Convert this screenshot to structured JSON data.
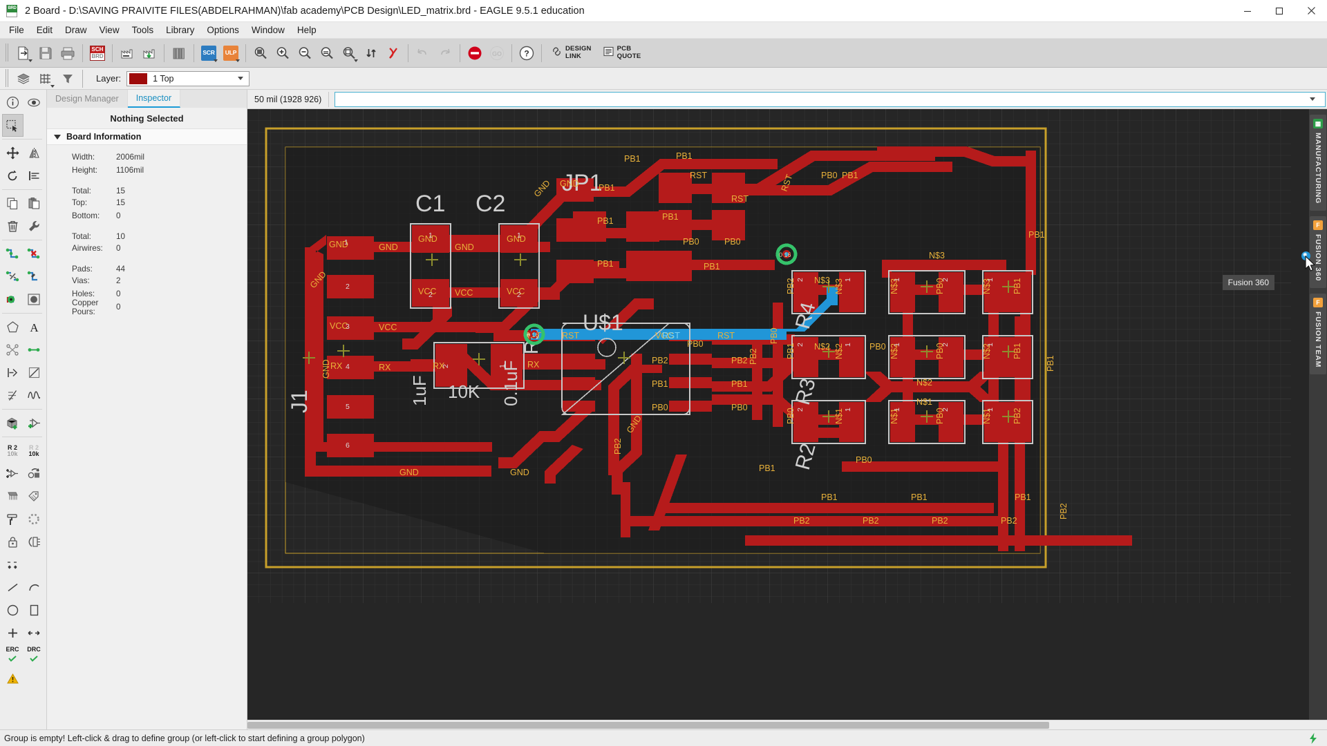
{
  "window": {
    "title": "2 Board - D:\\SAVING PRAIVITE FILES(ABDELRAHMAN)\\fab academy\\PCB Design\\LED_matrix.brd - EAGLE 9.5.1 education",
    "app_icon": "brd-file-icon",
    "minimize": "minimize-icon",
    "maximize": "maximize-icon",
    "close": "close-icon"
  },
  "menubar": {
    "items": [
      {
        "label": "File"
      },
      {
        "label": "Edit"
      },
      {
        "label": "Draw"
      },
      {
        "label": "View"
      },
      {
        "label": "Tools"
      },
      {
        "label": "Library"
      },
      {
        "label": "Options"
      },
      {
        "label": "Window"
      },
      {
        "label": "Help"
      }
    ]
  },
  "toolbar": {
    "buttons": [
      {
        "name": "open-file-button",
        "icon": "open-document-icon",
        "dropdown": true,
        "disabled": false
      },
      {
        "name": "save-button",
        "icon": "floppy-save-icon",
        "dropdown": false,
        "disabled": false
      },
      {
        "name": "print-button",
        "icon": "printer-icon",
        "dropdown": false,
        "disabled": false
      },
      {
        "name": "switch-to-schematic-button",
        "icon": "sch-brd-icon",
        "label_top": "SCH",
        "label_bottom": "BRD",
        "disabled": false
      },
      {
        "name": "cam-processor-button",
        "icon": "cam-factory-icon",
        "disabled": false
      },
      {
        "name": "generate-manufacturing-button",
        "icon": "cam-factory-download-icon",
        "disabled": false
      },
      {
        "name": "library-manager-button",
        "icon": "library-books-icon",
        "disabled": false
      },
      {
        "name": "run-script-button",
        "icon": "scr-icon",
        "label": "SCR",
        "dropdown": true,
        "color": "#2d7cc0"
      },
      {
        "name": "run-ulp-button",
        "icon": "ulp-icon",
        "label": "ULP",
        "dropdown": true,
        "color": "#e8833a"
      },
      {
        "name": "zoom-fit-button",
        "icon": "zoom-fit-icon",
        "disabled": false
      },
      {
        "name": "zoom-in-button",
        "icon": "zoom-in-icon",
        "disabled": false
      },
      {
        "name": "zoom-out-button",
        "icon": "zoom-out-icon",
        "disabled": false
      },
      {
        "name": "zoom-select-button",
        "icon": "zoom-select-icon",
        "disabled": false
      },
      {
        "name": "zoom-region-button",
        "icon": "zoom-region-icon",
        "dropdown": true,
        "disabled": false
      },
      {
        "name": "redraw-button",
        "icon": "refresh-arrows-icon",
        "disabled": false
      },
      {
        "name": "stop-ratsnest-button",
        "icon": "x-curve-icon",
        "color": "#e03030",
        "disabled": false
      },
      {
        "name": "undo-button",
        "icon": "undo-arrow-icon",
        "disabled": true
      },
      {
        "name": "redo-button",
        "icon": "redo-arrow-icon",
        "disabled": true
      },
      {
        "name": "stop-button",
        "icon": "stop-circle-icon",
        "color": "#d0021b",
        "disabled": false
      },
      {
        "name": "go-button",
        "icon": "go-circle-icon",
        "label": "GO",
        "disabled": true
      },
      {
        "name": "help-button",
        "icon": "question-mark-icon",
        "disabled": false
      }
    ],
    "design_link": {
      "line1": "DESIGN",
      "line2": "LINK",
      "icon": "link-chain-icon"
    },
    "pcb_quote": {
      "line1": "PCB",
      "line2": "QUOTE",
      "icon": "document-lines-icon"
    }
  },
  "layerbar": {
    "tools": [
      {
        "name": "layer-settings-button",
        "icon": "layers-stack-icon"
      },
      {
        "name": "grid-settings-button",
        "icon": "grid-icon",
        "dropdown": true
      },
      {
        "name": "display-filter-button",
        "icon": "funnel-filter-icon"
      }
    ],
    "label": "Layer:",
    "selected_layer": "1 Top",
    "selected_layer_color": "#9e0b0b"
  },
  "left_toolbar": {
    "rows": [
      [
        {
          "name": "info-tool",
          "icon": "info-circle-icon"
        },
        {
          "name": "show-tool",
          "icon": "eye-show-icon"
        }
      ],
      [
        {
          "name": "group-tool",
          "icon": "group-select-icon",
          "active": true
        }
      ],
      [
        {
          "name": "move-tool",
          "icon": "move-arrows-icon"
        },
        {
          "name": "mirror-tool",
          "icon": "mirror-icon"
        }
      ],
      [
        {
          "name": "rotate-tool",
          "icon": "rotate-ccw-icon"
        },
        {
          "name": "align-tool",
          "icon": "align-left-icon"
        }
      ],
      [
        {
          "name": "copy-tool",
          "icon": "copy-pages-icon"
        },
        {
          "name": "paste-tool",
          "icon": "clipboard-paste-icon"
        }
      ],
      [
        {
          "name": "delete-tool",
          "icon": "trash-bin-icon"
        },
        {
          "name": "change-tool",
          "icon": "wrench-icon"
        }
      ],
      [
        {
          "name": "route-tool",
          "icon": "route-airwire-icon"
        },
        {
          "name": "ripup-tool",
          "icon": "ripup-x-icon"
        }
      ],
      [
        {
          "name": "split-tool",
          "icon": "split-wire-icon"
        },
        {
          "name": "miter-tool",
          "icon": "miter-wire-icon"
        }
      ],
      [
        {
          "name": "via-tool",
          "icon": "via-green-icon"
        },
        {
          "name": "hole-tool",
          "icon": "hole-circle-icon"
        }
      ],
      [
        {
          "name": "polygon-tool",
          "icon": "pentagon-icon"
        },
        {
          "name": "text-tool",
          "icon": "letter-a-icon"
        }
      ],
      [
        {
          "name": "ratsnest-tool",
          "icon": "ratsnest-star-icon"
        },
        {
          "name": "wire-tool",
          "icon": "wire-line-icon"
        }
      ],
      [
        {
          "name": "signal-tool",
          "icon": "signal-arrow-icon"
        },
        {
          "name": "arc-tool",
          "icon": "arc-icon"
        }
      ],
      [
        {
          "name": "dimension-tool",
          "icon": "dimension-lines-icon"
        },
        {
          "name": "meander-tool",
          "icon": "meander-wave-icon"
        }
      ],
      [
        {
          "name": "add-part-tool",
          "icon": "add-package-icon"
        },
        {
          "name": "add-device-tool",
          "icon": "add-gate-icon"
        }
      ],
      [
        {
          "name": "value-tool",
          "icon": "value-r2-10k-icon",
          "line1": "R 2",
          "line2": "10k"
        },
        {
          "name": "name-tool",
          "icon": "name-r2-10k-icon",
          "line1": "R 2",
          "line2": "10k"
        }
      ],
      [
        {
          "name": "replace-tool",
          "icon": "replace-gate-icon"
        },
        {
          "name": "update-tool",
          "icon": "update-circle-square-icon"
        }
      ],
      [
        {
          "name": "package-tool",
          "icon": "ic-chip-icon"
        },
        {
          "name": "attribute-tool",
          "icon": "tag-attribute-icon"
        }
      ],
      [
        {
          "name": "paint-tool",
          "icon": "paint-roller-icon"
        },
        {
          "name": "optimize-tool",
          "icon": "dashed-circle-icon"
        }
      ],
      [
        {
          "name": "lock-tool",
          "icon": "padlock-icon"
        },
        {
          "name": "pinswap-tool",
          "icon": "pin-swap-icon"
        }
      ],
      [
        {
          "name": "smash-tool",
          "icon": "smash-arrows-icon"
        }
      ],
      [
        {
          "name": "line-tool",
          "icon": "straight-line-icon"
        },
        {
          "name": "curve-tool",
          "icon": "curve-line-icon"
        }
      ],
      [
        {
          "name": "circle-tool",
          "icon": "circle-shape-icon"
        },
        {
          "name": "rect-tool",
          "icon": "rectangle-shape-icon"
        }
      ],
      [
        {
          "name": "add-cross-tool",
          "icon": "plus-cross-icon"
        },
        {
          "name": "measure-tool",
          "icon": "measure-arrows-icon"
        }
      ],
      [
        {
          "name": "erc-button",
          "icon": "erc-check-icon",
          "label": "ERC"
        },
        {
          "name": "drc-button",
          "icon": "drc-check-icon",
          "label": "DRC"
        }
      ],
      [
        {
          "name": "warning-tool",
          "icon": "warning-triangle-icon"
        }
      ]
    ]
  },
  "panel": {
    "tabs": [
      {
        "label": "Design Manager",
        "active": false
      },
      {
        "label": "Inspector",
        "active": true
      }
    ],
    "selection_status": "Nothing Selected",
    "section": {
      "label": "Board Information",
      "expanded": true
    },
    "info": [
      {
        "key": "Width:",
        "value": "2006mil",
        "gap_before": false
      },
      {
        "key": "Height:",
        "value": "1106mil",
        "gap_before": false
      },
      {
        "key": "Total:",
        "value": "15",
        "gap_before": true
      },
      {
        "key": "Top:",
        "value": "15",
        "gap_before": false
      },
      {
        "key": "Bottom:",
        "value": "0",
        "gap_before": false
      },
      {
        "key": "Total:",
        "value": "10",
        "gap_before": true
      },
      {
        "key": "Airwires:",
        "value": "0",
        "gap_before": false
      },
      {
        "key": "Pads:",
        "value": "44",
        "gap_before": true
      },
      {
        "key": "Vias:",
        "value": "2",
        "gap_before": false
      },
      {
        "key": "Holes:",
        "value": "0",
        "gap_before": false
      },
      {
        "key": "Copper Pours:",
        "value": "0",
        "gap_before": false
      }
    ]
  },
  "coordbar": {
    "grid_and_coords": "50 mil (1928 926)",
    "command_value": "",
    "command_placeholder": ""
  },
  "right_rail": {
    "tabs": [
      {
        "label": "MANUFACTURING",
        "icon": "chip-green-icon",
        "icon_color": "#2e9e4a"
      },
      {
        "label": "FUSION 360",
        "icon": "fusion-f-icon",
        "icon_color": "#f2a13c"
      },
      {
        "label": "FUSION TEAM",
        "icon": "fusion-f-icon",
        "icon_color": "#f2a13c"
      }
    ],
    "tooltip": "Fusion 360"
  },
  "statusbar": {
    "message": "Group is empty! Left-click & drag to define group (or left-click to start defining a group polygon)",
    "icon": "lightning-bolt-icon",
    "icon_color": "#2e9e4a"
  },
  "canvas": {
    "background": "#262626",
    "grid_color": "#3a3a3a",
    "board_outline_color": "#c8a02a",
    "top_copper_color": "#b51b1b",
    "tplace_silk_color": "#c8c8c8",
    "net_label_color": "#e8b13a",
    "bottom_copper_color": "#2196d8",
    "via_ring_color": "#35c26a",
    "origin_cross_color": "#8d8d2e",
    "components": [
      {
        "ref": "JP1",
        "value": "",
        "type": "header"
      },
      {
        "ref": "C1",
        "value": "1uF",
        "type": "capacitor"
      },
      {
        "ref": "C2",
        "value": "0.1uF",
        "type": "capacitor"
      },
      {
        "ref": "R1",
        "value": "10K",
        "type": "resistor"
      },
      {
        "ref": "R2",
        "value": "",
        "type": "resistor"
      },
      {
        "ref": "R3",
        "value": "",
        "type": "resistor"
      },
      {
        "ref": "R4",
        "value": "",
        "type": "resistor"
      },
      {
        "ref": "U$1",
        "value": "",
        "type": "ic"
      },
      {
        "ref": "J1",
        "value": "",
        "type": "connector"
      }
    ],
    "nets": [
      "GND",
      "VCC",
      "RST",
      "RX",
      "PB0",
      "PB1",
      "PB2",
      "N$1",
      "N$2",
      "N$3"
    ],
    "via_labels": [
      "0 16",
      "0 16"
    ]
  }
}
